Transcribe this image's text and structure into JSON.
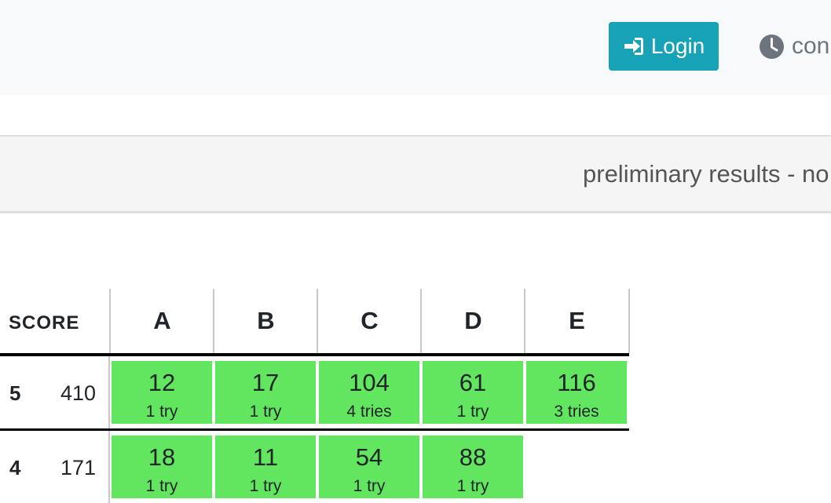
{
  "navbar": {
    "login_label": "Login",
    "clock_label": "con"
  },
  "banner": {
    "text": "preliminary results - no"
  },
  "scoreboard": {
    "score_header": "SCORE",
    "problems": [
      "A",
      "B",
      "C",
      "D",
      "E"
    ],
    "rows": [
      {
        "rank": "5",
        "points": "410",
        "cells": [
          {
            "time": "12",
            "tries": "1 try"
          },
          {
            "time": "17",
            "tries": "1 try"
          },
          {
            "time": "104",
            "tries": "4 tries"
          },
          {
            "time": "61",
            "tries": "1 try"
          },
          {
            "time": "116",
            "tries": "3 tries"
          }
        ]
      },
      {
        "rank": "4",
        "points": "171",
        "cells": [
          {
            "time": "18",
            "tries": "1 try"
          },
          {
            "time": "11",
            "tries": "1 try"
          },
          {
            "time": "54",
            "tries": "1 try"
          },
          {
            "time": "88",
            "tries": "1 try"
          }
        ]
      }
    ]
  },
  "colors": {
    "navbar_bg": "#f8f9fa",
    "login_bg": "#17a2b8",
    "solved_cell": "#62e660",
    "banner_bg": "#f5f5f5"
  },
  "icons": {
    "login": "sign-in-icon",
    "clock": "clock-icon"
  }
}
